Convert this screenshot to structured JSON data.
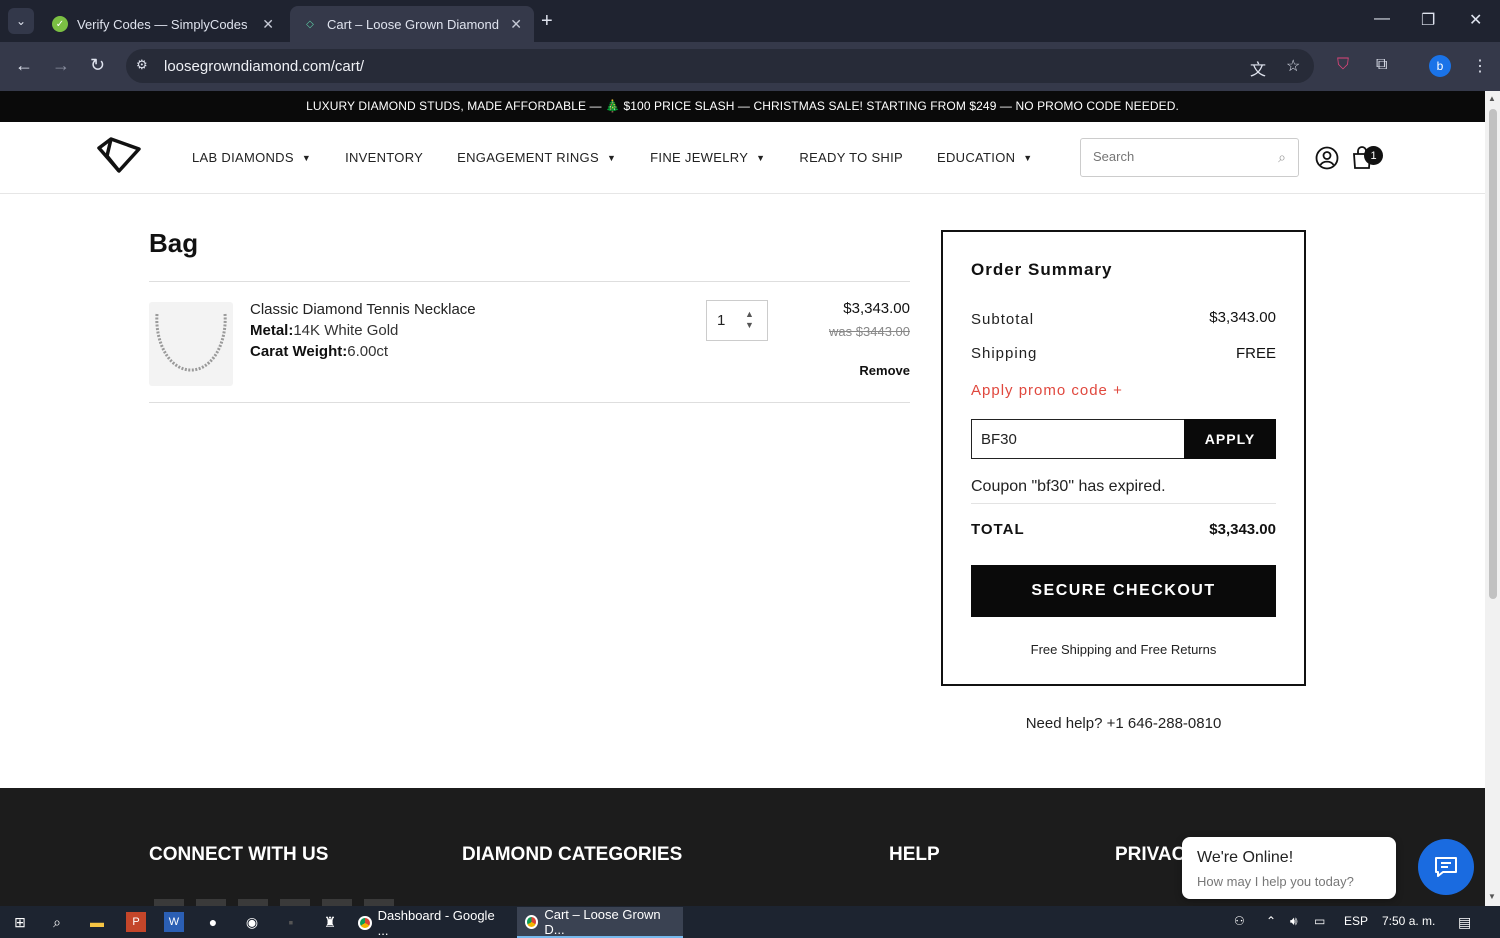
{
  "browser": {
    "tabs": [
      {
        "title": "Verify Codes — SimplyCodes",
        "active": false
      },
      {
        "title": "Cart – Loose Grown Diamond",
        "active": true
      }
    ],
    "url": "loosegrowndiamond.com/cart/",
    "profile_initial": "b"
  },
  "promo_banner": "LUXURY DIAMOND STUDS, MADE AFFORDABLE — 🎄 $100 PRICE SLASH — CHRISTMAS SALE! STARTING FROM $249 — NO PROMO CODE NEEDED.",
  "nav": {
    "items": [
      {
        "label": "LAB DIAMONDS",
        "dropdown": true
      },
      {
        "label": "INVENTORY",
        "dropdown": false
      },
      {
        "label": "ENGAGEMENT RINGS",
        "dropdown": true
      },
      {
        "label": "FINE JEWELRY",
        "dropdown": true
      },
      {
        "label": "READY TO SHIP",
        "dropdown": false
      },
      {
        "label": "EDUCATION",
        "dropdown": true
      }
    ],
    "search_placeholder": "Search",
    "cart_count": "1"
  },
  "bag": {
    "title": "Bag",
    "item": {
      "name": "Classic Diamond Tennis Necklace",
      "metal_label": "Metal:",
      "metal_value": "14K White Gold",
      "carat_label": "Carat Weight:",
      "carat_value": "6.00ct",
      "quantity": "1",
      "price": "$3,343.00",
      "was_price": "was $3443.00",
      "remove_label": "Remove"
    }
  },
  "summary": {
    "title": "Order Summary",
    "subtotal_label": "Subtotal",
    "subtotal_value": "$3,343.00",
    "shipping_label": "Shipping",
    "shipping_value": "FREE",
    "promo_link": "Apply promo code +",
    "coupon_value": "BF30",
    "apply_label": "APPLY",
    "coupon_message": "Coupon \"bf30\" has expired.",
    "total_label": "TOTAL",
    "total_value": "$3,343.00",
    "checkout_label": "SECURE CHECKOUT",
    "free_shipping_note": "Free Shipping and Free Returns",
    "help_text": "Need help? +1 646-288-0810"
  },
  "footer": {
    "headings": [
      "CONNECT WITH US",
      "DIAMOND CATEGORIES",
      "HELP",
      "PRIVAC"
    ]
  },
  "chat": {
    "title": "We're Online!",
    "subtitle": "How may I help you today?"
  },
  "taskbar": {
    "apps": [
      {
        "label": "Dashboard - Google ...",
        "active": false
      },
      {
        "label": "Cart – Loose Grown D...",
        "active": true
      }
    ],
    "language": "ESP",
    "time": "7:50 a. m."
  },
  "colors": {
    "accent_promo": "#e0483e",
    "chat_blue": "#1a6be0",
    "chrome_dark": "#1f2330"
  }
}
